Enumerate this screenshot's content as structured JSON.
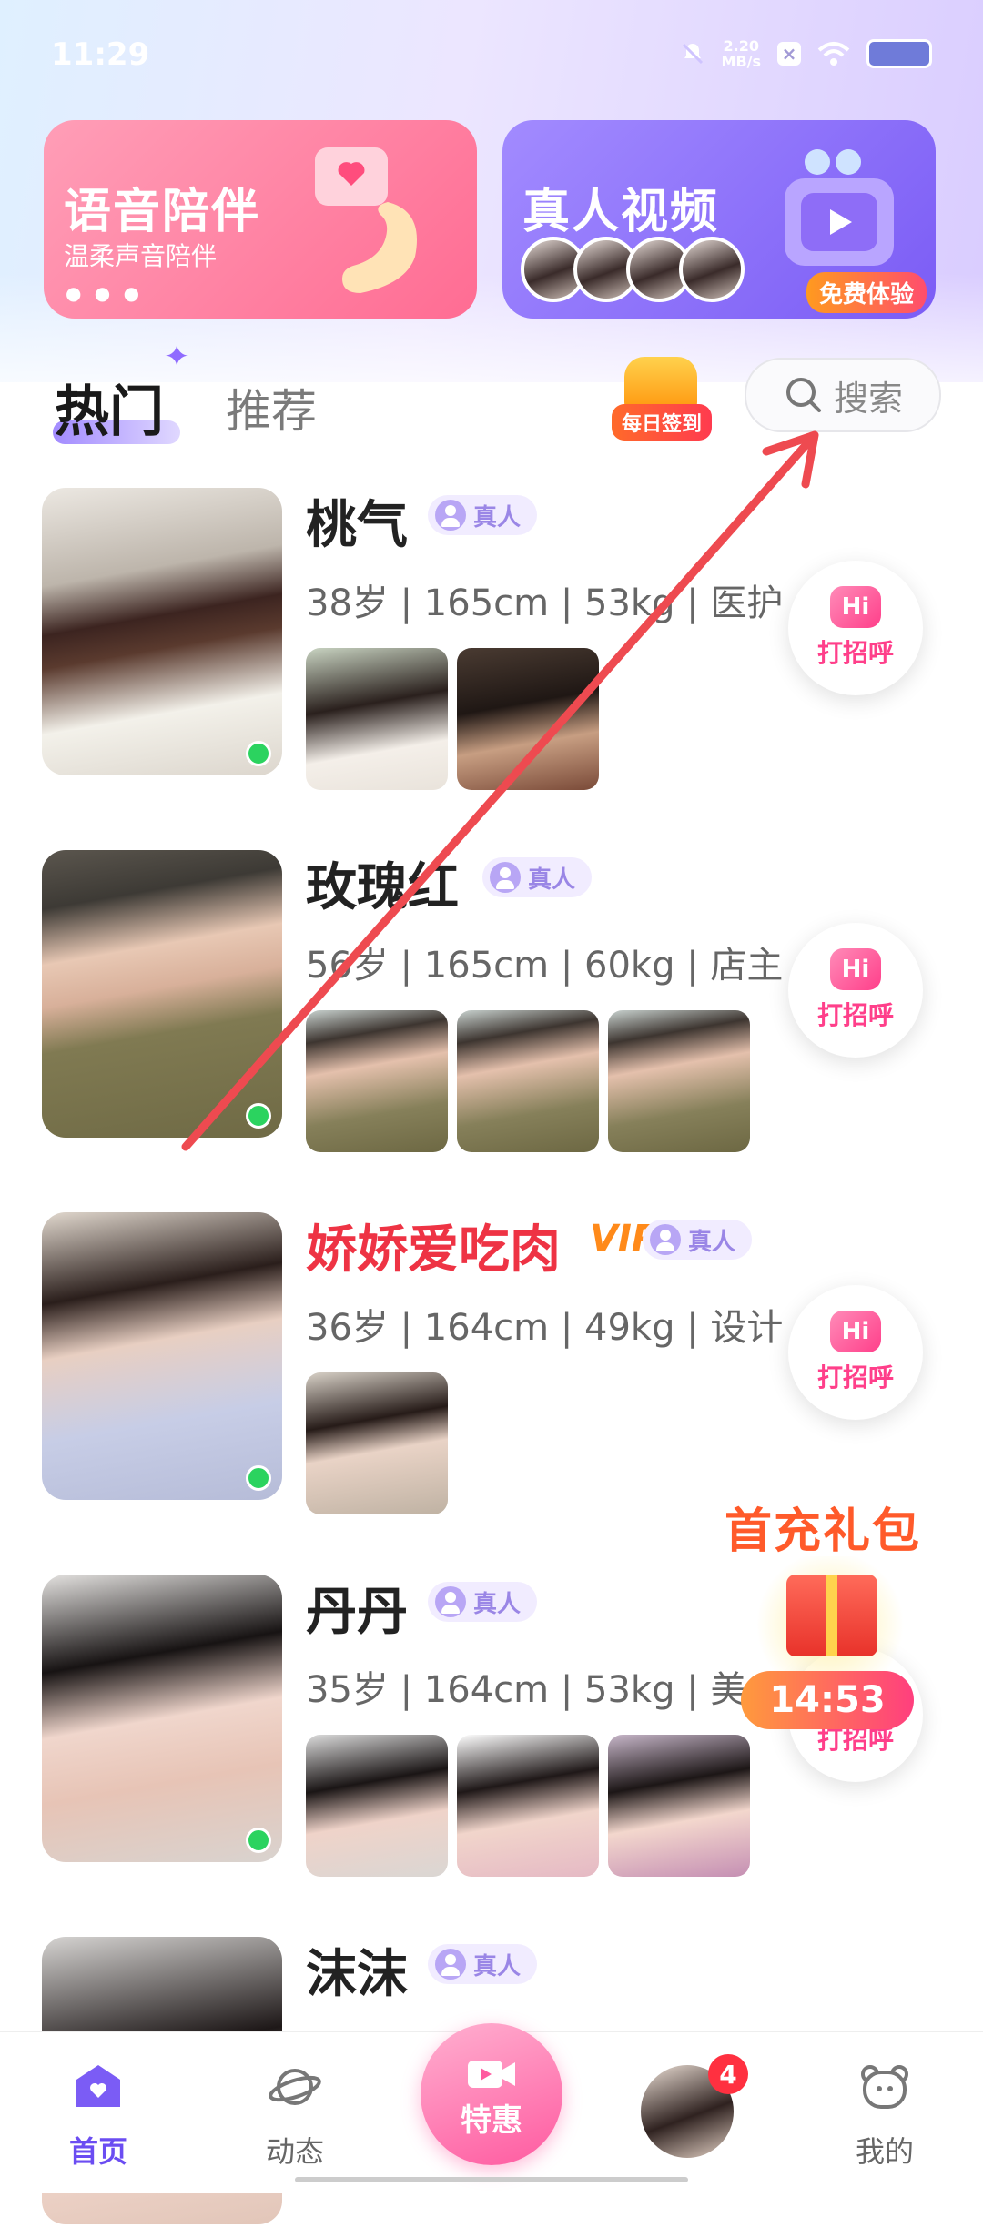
{
  "status_bar": {
    "time": "11:29",
    "net_speed": "2.20",
    "net_unit": "MB/s"
  },
  "banners": {
    "voice": {
      "title": "语音陪伴",
      "subtitle": "温柔声音陪伴"
    },
    "video": {
      "title": "真人视频",
      "badge": "免费体验"
    }
  },
  "tabs": {
    "hot": "热门",
    "recommend": "推荐"
  },
  "checkin": {
    "label": "每日签到"
  },
  "search": {
    "label": "搜索"
  },
  "real_label": "真人",
  "greet_label": "打招呼",
  "hi": "Hi",
  "profiles": [
    {
      "name": "桃气",
      "info": "38岁 | 165cm | 53kg | 医护",
      "vip": false,
      "photos": 2
    },
    {
      "name": "玫瑰红",
      "info": "56岁 | 165cm | 60kg | 店主",
      "vip": false,
      "photos": 3
    },
    {
      "name": "娇娇爱吃肉",
      "info": "36岁 | 164cm | 49kg | 设计",
      "vip": true,
      "vip_text": "VIP",
      "photos": 1
    },
    {
      "name": "丹丹",
      "info": "35岁 | 164cm | 53kg | 美",
      "vip": false,
      "photos": 3
    },
    {
      "name": "沫沫",
      "info": "",
      "vip": false,
      "photos": 0
    }
  ],
  "gift": {
    "title": "首充礼包",
    "timer": "14:53"
  },
  "bottom_nav": {
    "home": "首页",
    "dynamic": "动态",
    "special": "特惠",
    "mine": "我的",
    "message_badge": "4"
  },
  "colors": {
    "accent": "#6b4df2",
    "pink": "#ff3f8a",
    "vip_name": "#ee3344",
    "online": "#2bd35f"
  }
}
